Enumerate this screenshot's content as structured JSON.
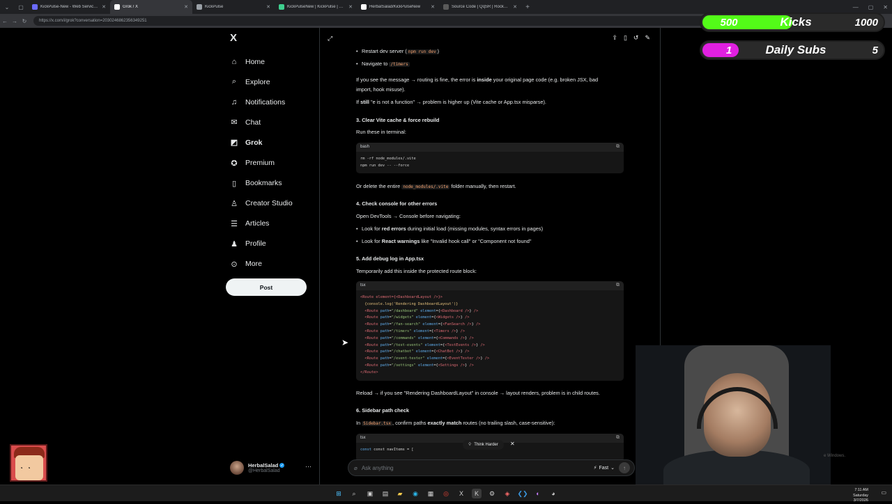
{
  "browser": {
    "tabs": [
      {
        "title": "KickPulse-New - Web Service - Re",
        "favicon_color": "#6b6bff",
        "active": false
      },
      {
        "title": "Grok / X",
        "favicon_color": "#ffffff",
        "active": true
      },
      {
        "title": "KickPulse",
        "favicon_color": "#9aa0a6",
        "active": false
      },
      {
        "title": "KickPulseNew | KickPulse | Supab",
        "favicon_color": "#3ecf8e",
        "active": false
      },
      {
        "title": "HerbalSalad/KickPulseNew",
        "favicon_color": "#ffffff",
        "active": false
      },
      {
        "title": "Source Code | QqSR | Rocket Pow",
        "favicon_color": "#5a5a5a",
        "active": false
      }
    ],
    "url": "https://x.com/i/grok?conversation=2030246862356349251"
  },
  "nav": {
    "items": [
      {
        "label": "Home",
        "icon": "home-icon",
        "glyph": "⌂",
        "bold": false
      },
      {
        "label": "Explore",
        "icon": "search-icon",
        "glyph": "⌕",
        "bold": false
      },
      {
        "label": "Notifications",
        "icon": "bell-icon",
        "glyph": "♫",
        "bold": false
      },
      {
        "label": "Chat",
        "icon": "chat-icon",
        "glyph": "✉",
        "bold": false
      },
      {
        "label": "Grok",
        "icon": "grok-icon",
        "glyph": "◩",
        "bold": true
      },
      {
        "label": "Premium",
        "icon": "premium-icon",
        "glyph": "✪",
        "bold": false
      },
      {
        "label": "Bookmarks",
        "icon": "bookmark-icon",
        "glyph": "▯",
        "bold": false
      },
      {
        "label": "Creator Studio",
        "icon": "creator-studio-icon",
        "glyph": "♙",
        "bold": false
      },
      {
        "label": "Articles",
        "icon": "articles-icon",
        "glyph": "☰",
        "bold": false
      },
      {
        "label": "Profile",
        "icon": "profile-icon",
        "glyph": "♟",
        "bold": false
      },
      {
        "label": "More",
        "icon": "more-icon",
        "glyph": "⊙",
        "bold": false
      }
    ],
    "post_label": "Post"
  },
  "profile": {
    "name": "HerbalSalad",
    "handle": "@HerbalSalad"
  },
  "content": {
    "bullet_restart_pre": "Restart dev server (",
    "bullet_restart_code": "npm run dev",
    "bullet_restart_post": ")",
    "bullet_navigate_pre": "Navigate to",
    "bullet_navigate_code": "/timers",
    "para1_pre": "If you see the message → routing is fine, the error is ",
    "para1_bold": "inside",
    "para1_post": " your original page code (e.g. broken JSX, bad",
    "para1_line2": "import, hook misuse).",
    "para2_pre": "If ",
    "para2_bold": "still",
    "para2_post": " \"e is not a function\" → problem is higher up (Vite cache or App.tsx misparse).",
    "h3": "3. Clear Vite cache & force rebuild",
    "run_these": "Run these in terminal:",
    "code1_lang": "bash",
    "code1_lines": [
      "rm -rf node_modules/.vite",
      "npm run dev -- --force"
    ],
    "delete_pre": "Or delete the entire",
    "delete_code": "node_modules/.vite",
    "delete_post": "folder manually, then restart.",
    "h4": "4. Check console for other errors",
    "open_devtools": "Open DevTools → Console before navigating:",
    "b4a_pre": "Look for ",
    "b4a_bold": "red errors",
    "b4a_post": " during initial load (missing modules, syntax errors in pages)",
    "b4b_pre": "Look for ",
    "b4b_bold": "React warnings",
    "b4b_post": " like \"Invalid hook call\" or \"Component not found\"",
    "h5": "5. Add debug log in App.tsx",
    "temp_add": "Temporarily add this inside the protected route block:",
    "code2_lang": "tsx",
    "code2_first": "<Route element={<DashboardLayout />}>",
    "code2_log": "  {console.log('Rendering DashboardLayout')}",
    "code2_routes": [
      {
        "path": "\"/dashboard\"",
        "comp": "Dashboard"
      },
      {
        "path": "\"/widgets\"",
        "comp": "Widgets"
      },
      {
        "path": "\"/fan-search\"",
        "comp": "FanSearch"
      },
      {
        "path": "\"/timers\"",
        "comp": "Timers"
      },
      {
        "path": "\"/commands\"",
        "comp": "Commands"
      },
      {
        "path": "\"/test-events\"",
        "comp": "TestEvents"
      },
      {
        "path": "\"/chatbot\"",
        "comp": "ChatBot"
      },
      {
        "path": "\"/event-tester\"",
        "comp": "EventTester"
      },
      {
        "path": "\"/settings\"",
        "comp": "Settings"
      }
    ],
    "code2_last": "</Route>",
    "reload_text": "Reload → if you see \"Rendering DashboardLayout\" in console → layout renders, problem is in child routes.",
    "h6": "6. Sidebar path check",
    "sidebar_pre": "In",
    "sidebar_code": "Sidebar.tsx",
    "sidebar_mid": ", confirm paths ",
    "sidebar_bold": "exactly match",
    "sidebar_post": " routes (no trailing slash, case-sensitive):",
    "code3_lang": "tsx",
    "code3_line": "const navItems = ["
  },
  "composer": {
    "think_harder": "Think Harder",
    "placeholder": "Ask anything",
    "mode": "Fast"
  },
  "overlay": {
    "kicks": {
      "current": "500",
      "label": "Kicks",
      "max": "1000",
      "progress": 0.5
    },
    "subs": {
      "current": "1",
      "label": "Daily Subs",
      "max": "5",
      "progress": 0.2
    },
    "watermark": "e Windows."
  },
  "taskbar": {
    "time": "7:11 AM",
    "day": "Saturday",
    "date": "3/7/2026"
  },
  "colors": {
    "kicks_fill": "#53fc18",
    "subs_fill": "#e020e0",
    "code_accent": "#f6a26f"
  }
}
